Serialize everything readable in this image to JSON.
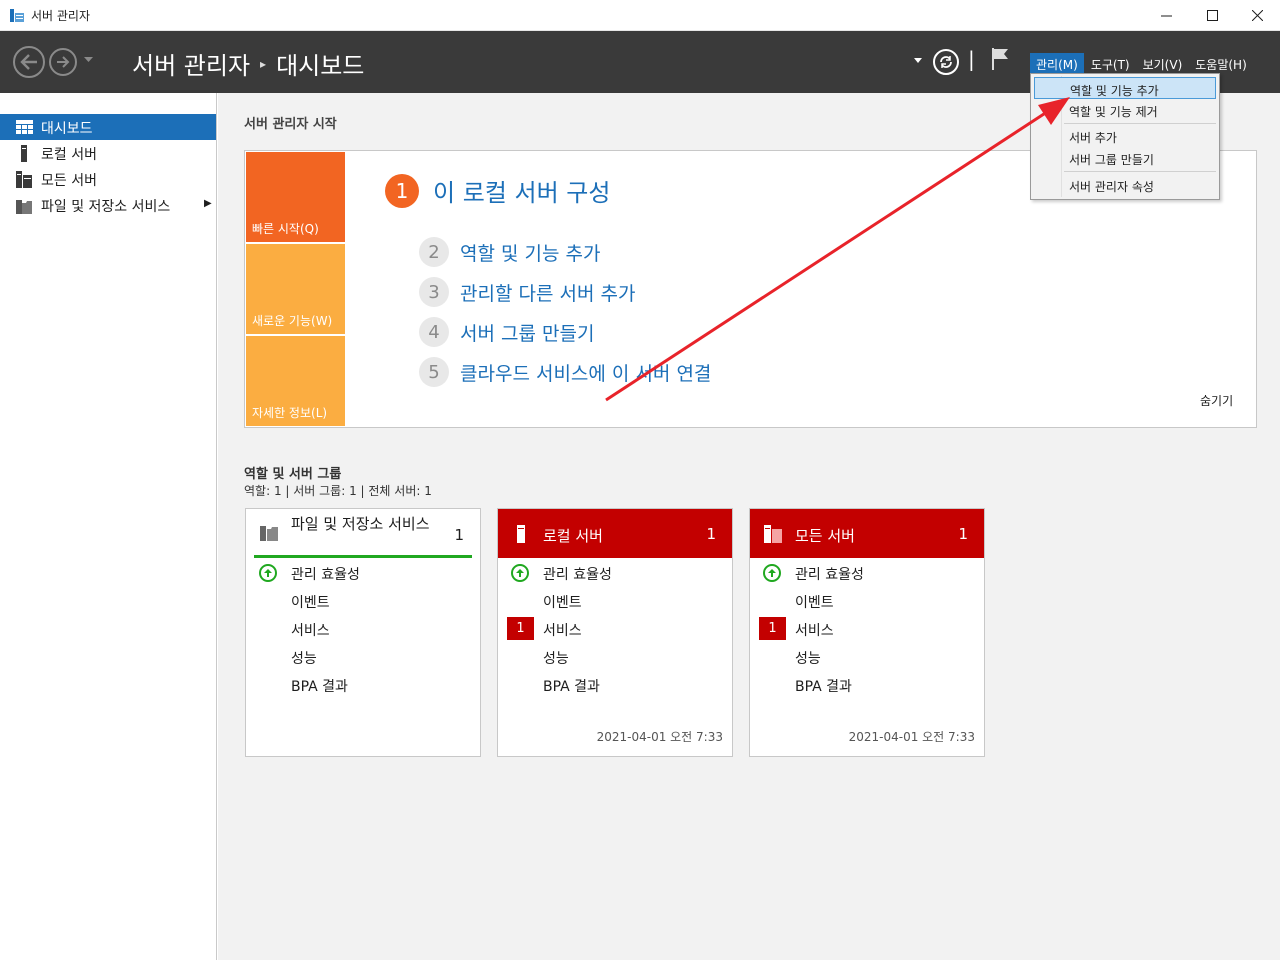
{
  "window": {
    "title": "서버 관리자"
  },
  "header": {
    "breadcrumb_root": "서버 관리자",
    "breadcrumb_current": "대시보드",
    "menus": [
      "관리(M)",
      "도구(T)",
      "보기(V)",
      "도움말(H)"
    ],
    "active_menu": "관리(M)"
  },
  "sidebar": {
    "items": [
      {
        "label": "대시보드",
        "icon": "dashboard-icon",
        "active": true
      },
      {
        "label": "로컬 서버",
        "icon": "server-icon"
      },
      {
        "label": "모든 서버",
        "icon": "servers-icon"
      },
      {
        "label": "파일 및 저장소 서비스",
        "icon": "file-storage-icon"
      }
    ]
  },
  "welcome": {
    "section_title": "서버 관리자 시작",
    "tiles": [
      "빠른 시작(Q)",
      "새로운 기능(W)",
      "자세한 정보(L)"
    ],
    "main_step": {
      "num": "1",
      "text": "이 로컬 서버 구성"
    },
    "steps": [
      {
        "num": "2",
        "text": "역할 및 기능 추가"
      },
      {
        "num": "3",
        "text": "관리할 다른 서버 추가"
      },
      {
        "num": "4",
        "text": "서버 그룹 만들기"
      },
      {
        "num": "5",
        "text": "클라우드 서비스에 이 서버 연결"
      }
    ],
    "hide": "숨기기"
  },
  "roles": {
    "title": "역할 및 서버 그룹",
    "counts": "역할: 1   |   서버 그룹: 1   |   전체 서버: 1",
    "cards": [
      {
        "title": "파일 및 저장소 서비스",
        "count": "1",
        "rows": [
          "관리 효율성",
          "이벤트",
          "서비스",
          "성능",
          "BPA 결과"
        ],
        "date": ""
      },
      {
        "title": "로컬 서버",
        "count": "1",
        "rows": [
          "관리 효율성",
          "이벤트",
          "서비스",
          "성능",
          "BPA 결과"
        ],
        "badge": "1",
        "date": "2021-04-01 오전 7:33"
      },
      {
        "title": "모든 서버",
        "count": "1",
        "rows": [
          "관리 효율성",
          "이벤트",
          "서비스",
          "성능",
          "BPA 결과"
        ],
        "badge": "1",
        "date": "2021-04-01 오전 7:33"
      }
    ]
  },
  "dropdown": {
    "items": [
      "역할 및 기능 추가",
      "역할 및 기능 제거",
      "서버 추가",
      "서버 그룹 만들기",
      "서버 관리자 속성"
    ],
    "highlighted": "역할 및 기능 추가"
  },
  "colors": {
    "accent": "#1c6fb8",
    "header": "#3a3a3a",
    "orange": "#f26522",
    "light_orange": "#fbad41",
    "alert_red": "#c30000",
    "ok_green": "#20a820",
    "annotation_arrow": "#e8232a"
  }
}
